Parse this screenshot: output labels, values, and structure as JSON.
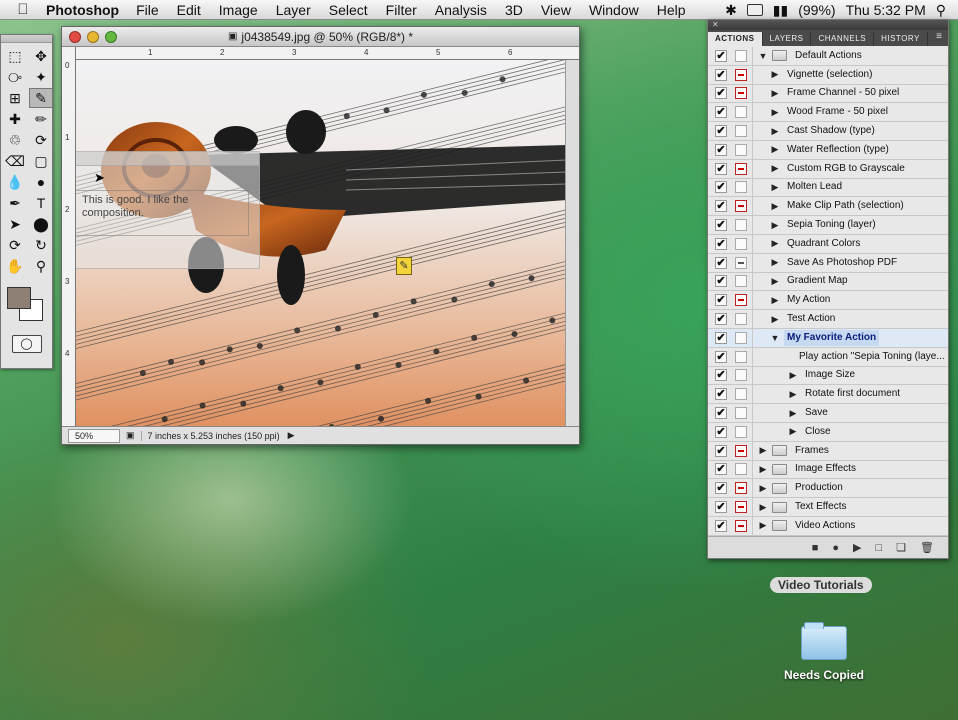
{
  "menubar": {
    "app_name": "Photoshop",
    "items": [
      "File",
      "Edit",
      "Image",
      "Layer",
      "Select",
      "Filter",
      "Analysis",
      "3D",
      "View",
      "Window",
      "Help"
    ],
    "battery": "(99%)",
    "clock": "Thu 5:32 PM"
  },
  "document": {
    "title": "j0438549.jpg @ 50% (RGB/8*) *",
    "zoom": "50%",
    "info": "7 inches x 5.253 inches (150 ppi)",
    "ruler_top": [
      "0",
      "1",
      "2",
      "3",
      "4",
      "5",
      "6"
    ],
    "ruler_left": [
      "0",
      "1",
      "2",
      "3",
      "4"
    ],
    "note_text": "This is good.  I like the composition."
  },
  "panel": {
    "tabs": [
      "ACTIONS",
      "LAYERS",
      "CHANNELS",
      "HISTORY"
    ],
    "rows": [
      {
        "label": "Default Actions",
        "level": 0,
        "folder": true,
        "expanded": true,
        "dialog": "none"
      },
      {
        "label": "Vignette (selection)",
        "level": 1,
        "dialog": "red"
      },
      {
        "label": "Frame Channel - 50 pixel",
        "level": 1,
        "dialog": "red"
      },
      {
        "label": "Wood Frame - 50 pixel",
        "level": 1,
        "dialog": "none"
      },
      {
        "label": "Cast Shadow (type)",
        "level": 1,
        "dialog": "none"
      },
      {
        "label": "Water Reflection (type)",
        "level": 1,
        "dialog": "none"
      },
      {
        "label": "Custom RGB to Grayscale",
        "level": 1,
        "dialog": "red"
      },
      {
        "label": "Molten Lead",
        "level": 1,
        "dialog": "none"
      },
      {
        "label": "Make Clip Path (selection)",
        "level": 1,
        "dialog": "red"
      },
      {
        "label": "Sepia Toning (layer)",
        "level": 1,
        "dialog": "none"
      },
      {
        "label": "Quadrant Colors",
        "level": 1,
        "dialog": "none"
      },
      {
        "label": "Save As Photoshop PDF",
        "level": 1,
        "dialog": "part"
      },
      {
        "label": "Gradient Map",
        "level": 1,
        "dialog": "none"
      },
      {
        "label": "My Action",
        "level": 1,
        "dialog": "red"
      },
      {
        "label": "Test Action",
        "level": 1,
        "dialog": "none"
      },
      {
        "label": "My Favorite Action",
        "level": 1,
        "expanded": true,
        "selected": true,
        "dialog": "none"
      },
      {
        "label": "Play action \"Sepia Toning (laye...",
        "level": 2,
        "notri": true,
        "dialog": "none"
      },
      {
        "label": "Image Size",
        "level": 2,
        "dialog": "none"
      },
      {
        "label": "Rotate first document",
        "level": 2,
        "dialog": "none"
      },
      {
        "label": "Save",
        "level": 2,
        "dialog": "none"
      },
      {
        "label": "Close",
        "level": 2,
        "dialog": "none"
      },
      {
        "label": "Frames",
        "level": 0,
        "folder": true,
        "dialog": "red"
      },
      {
        "label": "Image Effects",
        "level": 0,
        "folder": true,
        "dialog": "none"
      },
      {
        "label": "Production",
        "level": 0,
        "folder": true,
        "dialog": "red"
      },
      {
        "label": "Text Effects",
        "level": 0,
        "folder": true,
        "dialog": "red"
      },
      {
        "label": "Video Actions",
        "level": 0,
        "folder": true,
        "dialog": "red"
      }
    ],
    "bottom_icons": [
      "stop-icon",
      "record-icon",
      "play-icon",
      "new-set-icon",
      "new-action-icon",
      "delete-icon"
    ]
  },
  "desktop": {
    "video_tutorials": "Video Tutorials",
    "needs_copied": "Needs Copied"
  },
  "colors": {
    "foreground_swatch": "#8d7f74",
    "background_swatch": "#ffffff",
    "selection_highlight": "#c5d9f1"
  }
}
